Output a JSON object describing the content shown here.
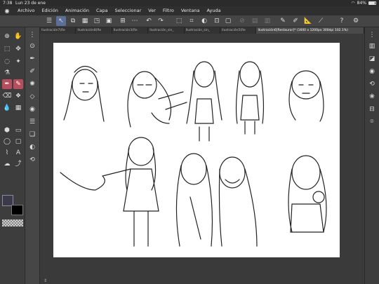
{
  "status": {
    "time": "7:38",
    "date": "Lun 23 de ene",
    "battery": "84%",
    "battery_level": 0.84
  },
  "menu": [
    "Archivo",
    "Edición",
    "Animación",
    "Capa",
    "Seleccionar",
    "Ver",
    "Filtro",
    "Ventana",
    "Ayuda"
  ],
  "tabs": [
    "Ilustración7(Re",
    "Ilustración8(Re",
    "Ilustración3(Re",
    "Ilustración_sin_",
    "Ilustración_sin_",
    "Ilustración5(Re",
    "Ilustración6[Restaurar]* (1600 x 1200px 300dpi 102.1%)"
  ],
  "icons": {
    "command_bar": [
      "menu-icon",
      "select-arrow-icon",
      "layer-move-icon",
      "fill-icon",
      "transform-icon",
      "undo-icon",
      "redo-icon",
      "deselect-icon",
      "crop-icon",
      "invert-icon",
      "expand-icon",
      "clear-icon",
      "pen-icon",
      "ruler-icon",
      "help-icon",
      "settings-icon"
    ],
    "tools": [
      "zoom-icon",
      "move-icon",
      "select-icon",
      "lasso-icon",
      "eyedropper-icon",
      "pen-tool-icon",
      "brush-tool-icon",
      "eraser-icon",
      "blend-icon",
      "fill-bucket-icon",
      "gradient-icon",
      "shape-icon",
      "text-icon",
      "balloon-icon"
    ]
  },
  "colors": {
    "main": "#3a3a48",
    "sub": "#000000",
    "accent": "#5b6f99",
    "active_tool": "#b84d5d"
  }
}
